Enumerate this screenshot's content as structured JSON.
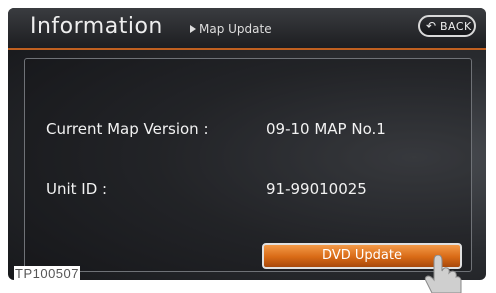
{
  "header": {
    "title": "Information",
    "subtitle": "Map Update",
    "back_label": "BACK",
    "back_icon": "back-arrow-icon"
  },
  "info": {
    "map_version_label": "Current Map Version :",
    "map_version_value": "09-10 MAP No.1",
    "unit_id_label": "Unit ID :",
    "unit_id_value": "91-99010025"
  },
  "actions": {
    "dvd_update_label": "DVD Update"
  },
  "caption": "TP100507",
  "colors": {
    "accent": "#d86a16",
    "screen_bg": "#1d1e21",
    "text": "#f2f2f2"
  }
}
